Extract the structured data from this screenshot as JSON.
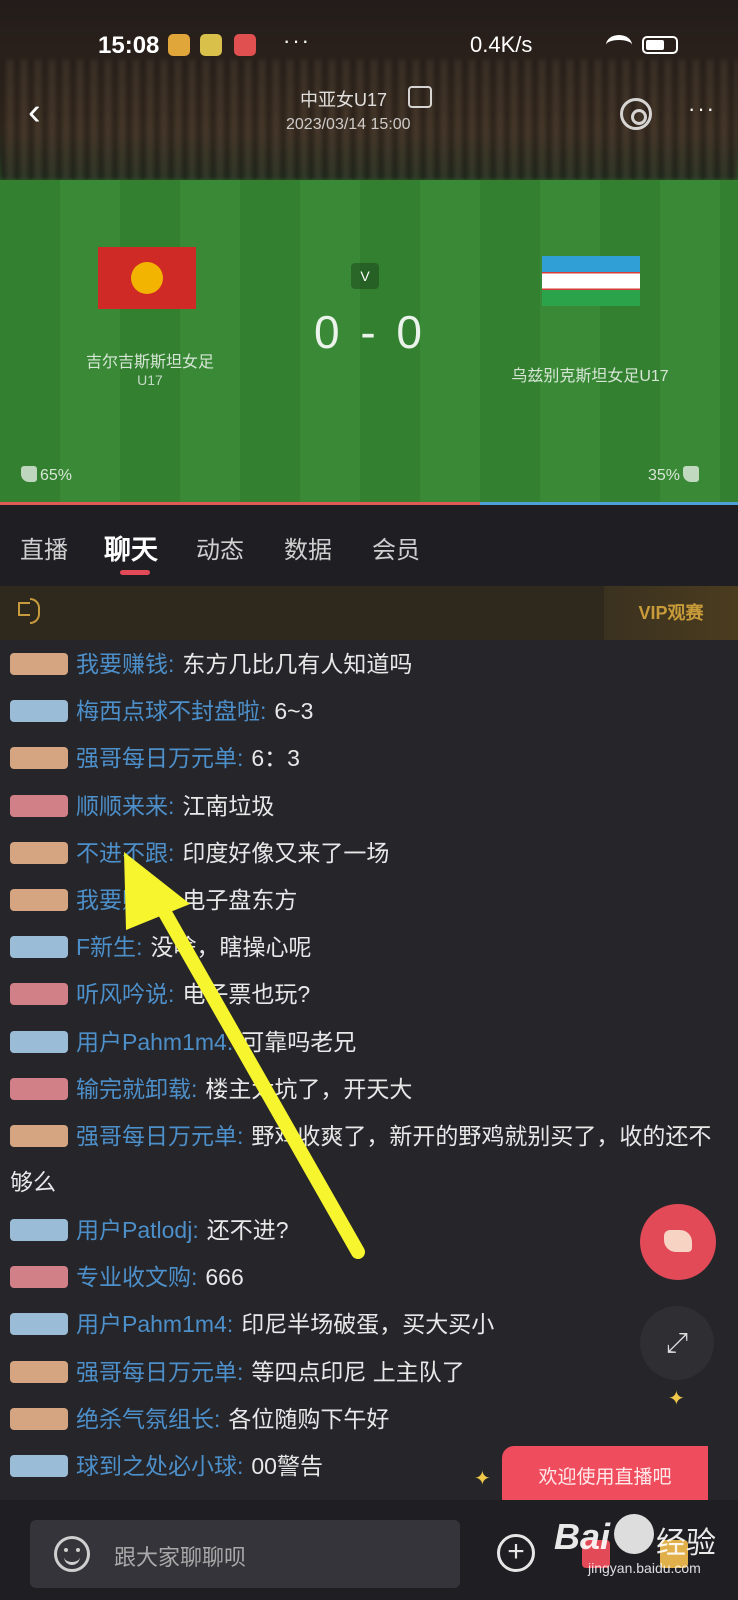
{
  "status_bar": {
    "time": "15:08",
    "network_speed": "0.4K/s",
    "more": "···"
  },
  "header": {
    "title": "中亚女U17",
    "datetime": "2023/03/14 15:00",
    "more": "···"
  },
  "match": {
    "home_team": "吉尔吉斯斯坦女足",
    "home_team_sub": "U17",
    "away_team": "乌兹别克斯坦女足U17",
    "score": "0 - 0",
    "badge": "V",
    "home_like_pct": "65%",
    "away_like_pct": "35%",
    "home_vote_fraction": 0.65,
    "colors": {
      "home": "#e05a57",
      "away": "#4ea0d8"
    }
  },
  "tabs": [
    {
      "label": "直播"
    },
    {
      "label": "聊天"
    },
    {
      "label": "动态"
    },
    {
      "label": "数据"
    },
    {
      "label": "会员"
    }
  ],
  "active_tab": "聊天",
  "notice": {
    "vip_label": "VIP观赛"
  },
  "chat": {
    "messages": [
      {
        "badge": "orange",
        "user": "我要赚钱",
        "text": "东方几比几有人知道吗"
      },
      {
        "badge": "blue",
        "user": "梅西点球不封盘啦",
        "text": "6~3"
      },
      {
        "badge": "orange",
        "user": "强哥每日万元单",
        "text": "6：3"
      },
      {
        "badge": "red",
        "user": "顺顺来来",
        "text": "江南垃圾"
      },
      {
        "badge": "orange",
        "user": "不进不跟",
        "text": "印度好像又来了一场"
      },
      {
        "badge": "orange",
        "user": "我要赚钱",
        "text": "电子盘东方"
      },
      {
        "badge": "blue",
        "user": "F新生",
        "text": "没啥，瞎操心呢"
      },
      {
        "badge": "red",
        "user": "听风吟说",
        "text": "电子票也玩?"
      },
      {
        "badge": "blue",
        "user": "用户Pahm1m4",
        "text": "可靠吗老兄"
      },
      {
        "badge": "red",
        "user": "输完就卸载",
        "text": "楼主太坑了，开天大"
      },
      {
        "badge": "orange",
        "user": "强哥每日万元单",
        "text": "野鸡收爽了，新开的野鸡就别买了，收的还不够么"
      },
      {
        "badge": "blue",
        "user": "用户Patlodj",
        "text": "还不进?"
      },
      {
        "badge": "red",
        "user": "专业收文购",
        "text": "666"
      },
      {
        "badge": "blue",
        "user": "用户Pahm1m4",
        "text": "印尼半场破蛋，买大买小"
      },
      {
        "badge": "orange",
        "user": "强哥每日万元单",
        "text": "等四点印尼 上主队了"
      },
      {
        "badge": "orange",
        "user": "绝杀气氛组长",
        "text": "各位随购下午好"
      },
      {
        "badge": "blue",
        "user": "球到之处必小球",
        "text": "00警告"
      }
    ]
  },
  "welcome_pill": "欢迎使用直播吧",
  "input": {
    "placeholder": "跟大家聊聊呗"
  },
  "watermark": {
    "brand": "Bai",
    "product": "经验",
    "url": "jingyan.baidu.com"
  },
  "icons": [
    "back-icon",
    "settings-icon",
    "more-icon",
    "speaker-icon",
    "thumb-up-icon",
    "emoji-icon",
    "plus-icon",
    "gift-icon",
    "expand-icon"
  ]
}
